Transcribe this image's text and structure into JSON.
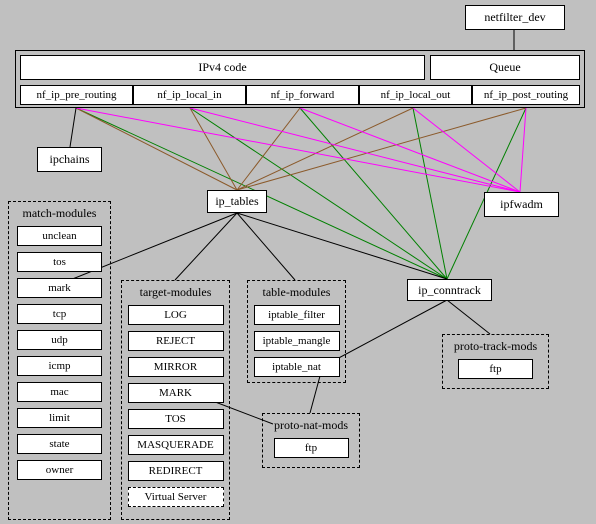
{
  "netfilter_dev": "netfilter_dev",
  "ipv4_code": "IPv4 code",
  "queue": "Queue",
  "hooks": {
    "pre_routing": "nf_ip_pre_routing",
    "local_in": "nf_ip_local_in",
    "forward": "nf_ip_forward",
    "local_out": "nf_ip_local_out",
    "post_routing": "nf_ip_post_routing"
  },
  "ipchains": "ipchains",
  "ipfwadm": "ipfwadm",
  "ip_tables": "ip_tables",
  "ip_conntrack": "ip_conntrack",
  "match_modules": {
    "header": "match-modules",
    "items": [
      "unclean",
      "tos",
      "mark",
      "tcp",
      "udp",
      "icmp",
      "mac",
      "limit",
      "state",
      "owner"
    ]
  },
  "target_modules": {
    "header": "target-modules",
    "items": [
      "LOG",
      "REJECT",
      "MIRROR",
      "MARK",
      "TOS",
      "MASQUERADE",
      "REDIRECT",
      "Virtual Server"
    ]
  },
  "table_modules": {
    "header": "table-modules",
    "items": [
      "iptable_filter",
      "iptable_mangle",
      "iptable_nat"
    ]
  },
  "proto_nat_mods": {
    "header": "proto-nat-mods",
    "items": [
      "ftp"
    ]
  },
  "proto_track_mods": {
    "header": "proto-track-mods",
    "items": [
      "ftp"
    ]
  }
}
